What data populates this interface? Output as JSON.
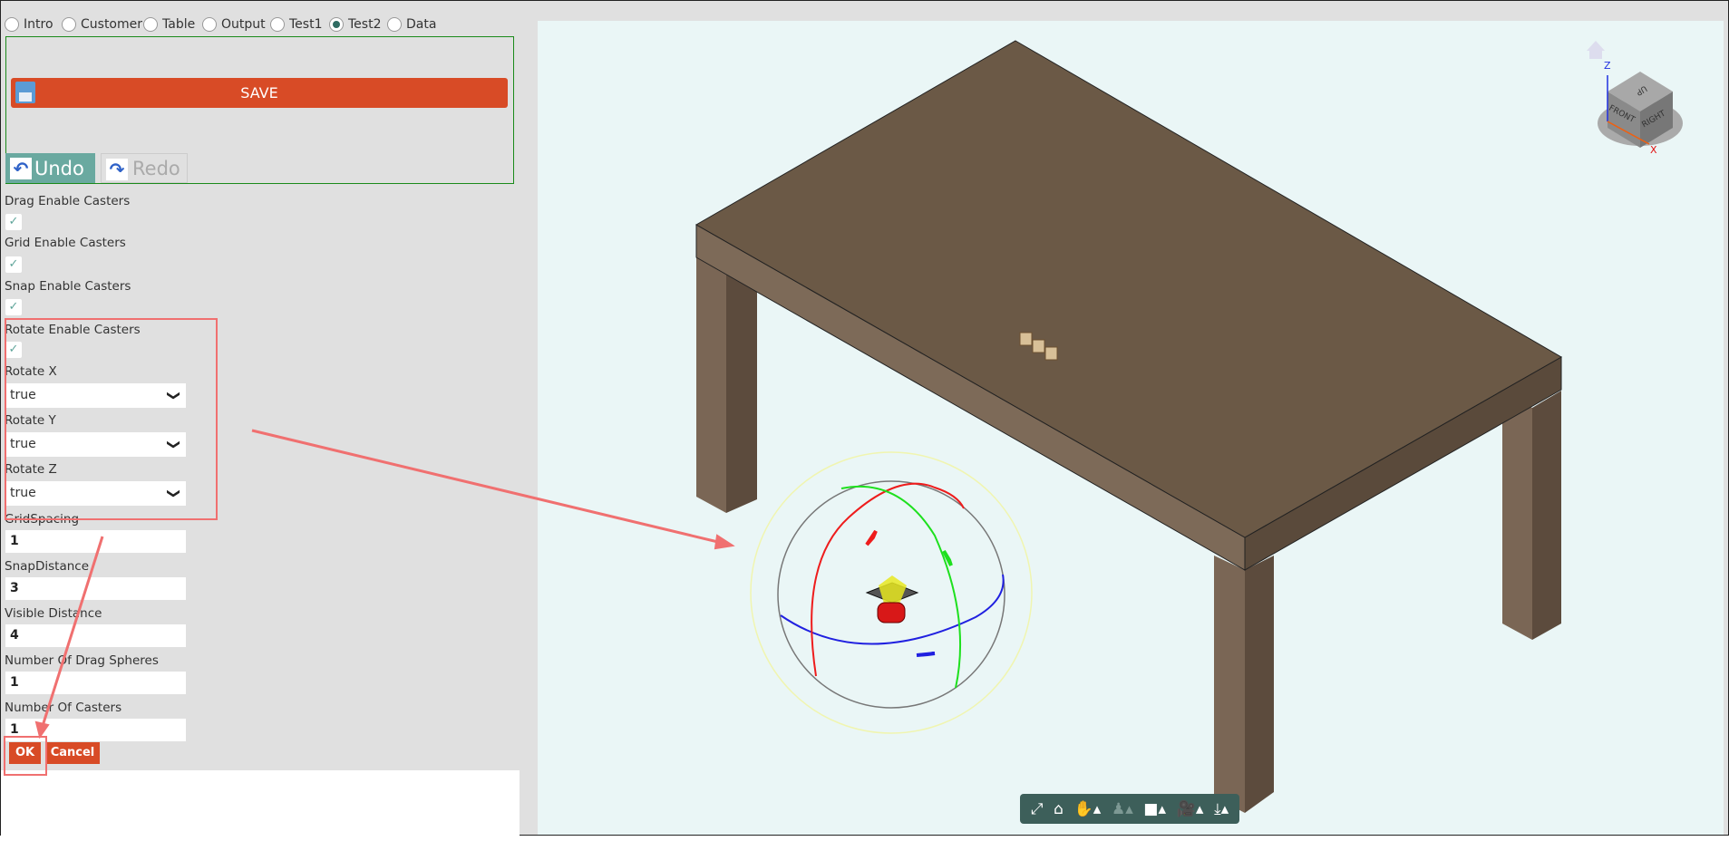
{
  "tabs": [
    {
      "label": "Intro",
      "selected": false
    },
    {
      "label": "Customer",
      "selected": false
    },
    {
      "label": "Table",
      "selected": false
    },
    {
      "label": "Output",
      "selected": false
    },
    {
      "label": "Test1",
      "selected": false
    },
    {
      "label": "Test2",
      "selected": true
    },
    {
      "label": "Data",
      "selected": false
    }
  ],
  "toolbar": {
    "save_label": "SAVE",
    "undo_label": "Undo",
    "redo_label": "Redo"
  },
  "form": {
    "checkboxes": [
      {
        "label": "Drag Enable Casters",
        "checked": true
      },
      {
        "label": "Grid Enable Casters",
        "checked": true
      },
      {
        "label": "Snap Enable Casters",
        "checked": true
      },
      {
        "label": "Rotate Enable Casters",
        "checked": true
      }
    ],
    "selects": [
      {
        "label": "Rotate X",
        "value": "true"
      },
      {
        "label": "Rotate Y",
        "value": "true"
      },
      {
        "label": "Rotate Z",
        "value": "true"
      }
    ],
    "inputs": [
      {
        "label": "GridSpacing",
        "value": "1"
      },
      {
        "label": "SnapDistance",
        "value": "3"
      },
      {
        "label": "Visible Distance",
        "value": "4"
      },
      {
        "label": "Number Of Drag Spheres",
        "value": "1"
      },
      {
        "label": "Number Of Casters",
        "value": "1"
      }
    ],
    "ok_label": "OK",
    "cancel_label": "Cancel",
    "check_glyph": "✓",
    "chevron_glyph": "❯"
  },
  "viewer": {
    "navcube": {
      "top": "UP",
      "front": "FRONT",
      "right": "RIGHT",
      "axis_z": "Z",
      "axis_x": "X"
    },
    "toolbar_icons": [
      "fullscreen-icon",
      "home-icon",
      "pan-hand-icon",
      "walk-person-icon",
      "cube-view-icon",
      "camera-icon",
      "download-icon"
    ]
  },
  "colors": {
    "accent": "#d84b26",
    "undo": "#6aa9a0",
    "toolbar": "#3d5f5a",
    "viewport": "#eaf6f6",
    "annotation": "#f07070"
  }
}
